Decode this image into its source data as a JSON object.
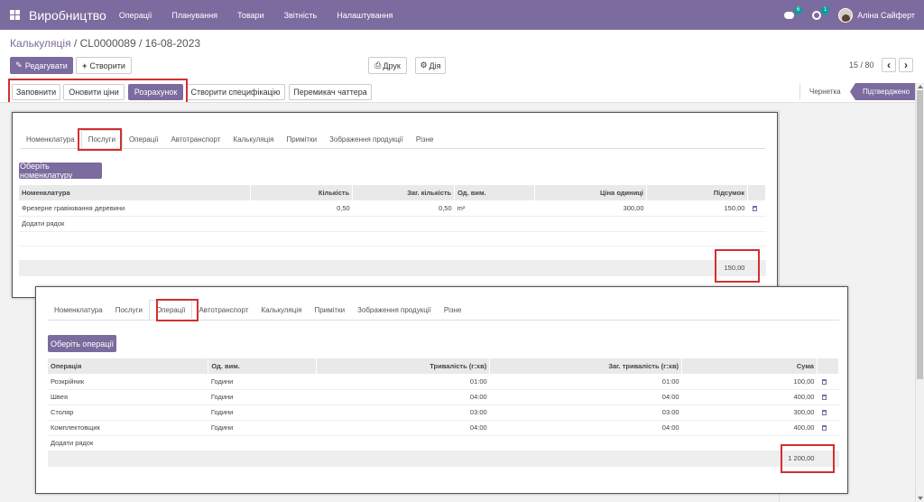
{
  "topbar": {
    "app_title": "Виробництво",
    "menu": [
      "Операції",
      "Планування",
      "Товари",
      "Звітність",
      "Налаштування"
    ],
    "chat_badge": "6",
    "activity_badge": "1",
    "user_name": "Аліна Сайферт",
    "color": "#7c6b9e"
  },
  "breadcrumb": {
    "parent": "Калькуляція",
    "separator": " / ",
    "current": "CL0000089 / 16-08-2023"
  },
  "control": {
    "edit_label": "Редагувати",
    "create_label": "Створити",
    "print_label": "Друк",
    "action_label": "Дія",
    "pager": "15 / 80",
    "prev": "‹",
    "next": "›"
  },
  "header_buttons": [
    "Заповнити",
    "Оновити ціни",
    "Розрахунок",
    "Створити специфікацію",
    "Перемикач чаттера"
  ],
  "statusbar": {
    "draft": "Чернетка",
    "confirmed": "Підтверджено"
  },
  "panel1": {
    "tabs": [
      "Номенклатура",
      "Послуги",
      "Операції",
      "Автотранспорт",
      "Калькуляція",
      "Примітки",
      "Зображення продукції",
      "Різне"
    ],
    "active_tab": "Послуги",
    "select_button": "Оберіть номенклатуру",
    "columns": [
      "Номенклатура",
      "Кількість",
      "Заг. кількість",
      "Од. вим.",
      "Ціна одиниці",
      "Підсумок"
    ],
    "rows": [
      {
        "name": "Фрезерне гравіювання деревини",
        "qty": "0,50",
        "total_qty": "0,50",
        "uom": "m²",
        "price": "300,00",
        "subtotal": "150,00"
      }
    ],
    "add_line": "Додати рядок",
    "total": "150,00"
  },
  "panel2": {
    "tabs": [
      "Номенклатура",
      "Послуги",
      "Операції",
      "Автотранспорт",
      "Калькуляція",
      "Примітки",
      "Зображення продукції",
      "Різне"
    ],
    "active_tab": "Операції",
    "select_button": "Оберіть операції",
    "columns": [
      "Операція",
      "Од. вим.",
      "Тривалість (г:хв)",
      "Заг. тривалість (г:хв)",
      "Сума"
    ],
    "rows": [
      {
        "op": "Розкрійник",
        "uom": "Години",
        "duration": "01:00",
        "total_duration": "01:00",
        "sum": "100,00"
      },
      {
        "op": "Швея",
        "uom": "Години",
        "duration": "04:00",
        "total_duration": "04:00",
        "sum": "400,00"
      },
      {
        "op": "Столяр",
        "uom": "Години",
        "duration": "03:00",
        "total_duration": "03:00",
        "sum": "300,00"
      },
      {
        "op": "Комплектовщик",
        "uom": "Години",
        "duration": "04:00",
        "total_duration": "04:00",
        "sum": "400,00"
      }
    ],
    "add_line": "Додати рядок",
    "total": "1 200,00"
  }
}
